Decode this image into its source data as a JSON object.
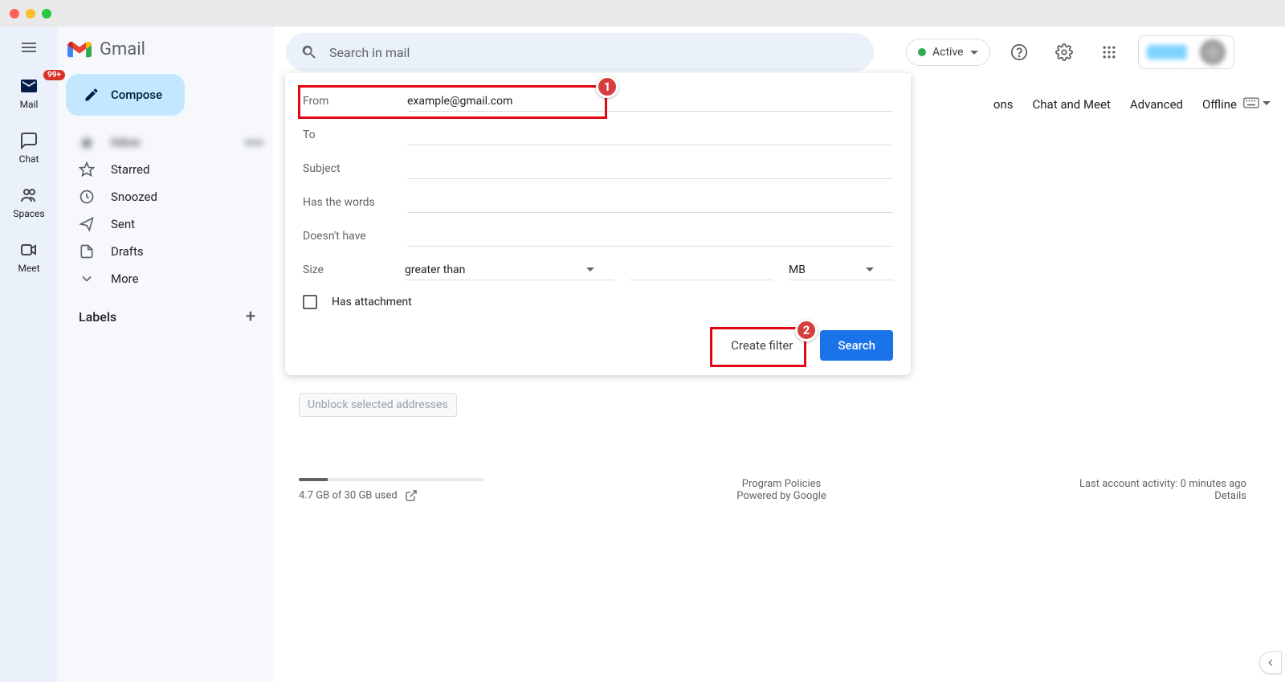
{
  "app_name": "Gmail",
  "mail_badge": "99+",
  "rail": {
    "mail": "Mail",
    "chat": "Chat",
    "spaces": "Spaces",
    "meet": "Meet"
  },
  "compose_label": "Compose",
  "sidebar_items": {
    "inbox": {
      "label": "Inbox",
      "count": ""
    },
    "starred": {
      "label": "Starred"
    },
    "snoozed": {
      "label": "Snoozed"
    },
    "sent": {
      "label": "Sent"
    },
    "drafts": {
      "label": "Drafts"
    },
    "more": {
      "label": "More"
    }
  },
  "labels_header": "Labels",
  "search_placeholder": "Search in mail",
  "status_label": "Active",
  "filter_panel": {
    "from_label": "From",
    "from_value": "example@gmail.com",
    "to_label": "To",
    "subject_label": "Subject",
    "has_words_label": "Has the words",
    "doesnt_have_label": "Doesn't have",
    "size_label": "Size",
    "size_op": "greater than",
    "size_unit": "MB",
    "has_attachment_label": "Has attachment",
    "create_filter": "Create filter",
    "search_btn": "Search"
  },
  "settings_tabs": {
    "t1": "ons",
    "t2": "Chat and Meet",
    "t3": "Advanced",
    "t4": "Offline"
  },
  "unblock_btn": "Unblock selected addresses",
  "footer": {
    "storage": "4.7 GB of 30 GB used",
    "policies": "Program Policies",
    "powered": "Powered by Google",
    "activity": "Last account activity: 0 minutes ago",
    "details": "Details"
  },
  "anno": {
    "b1": "1",
    "b2": "2"
  }
}
